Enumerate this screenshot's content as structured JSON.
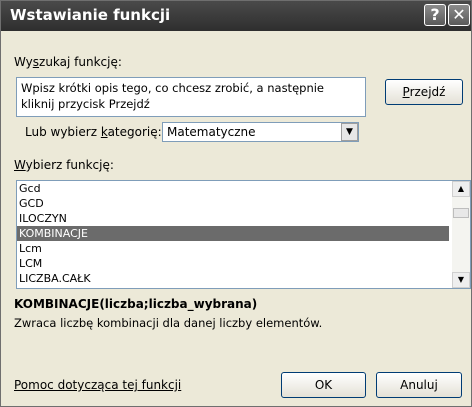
{
  "window": {
    "title": "Wstawianie funkcji",
    "help_glyph": "?",
    "close_glyph": "✕"
  },
  "search": {
    "label_pre": "Wy",
    "label_key": "s",
    "label_post": "zukaj funkcję:",
    "value": "Wpisz krótki opis tego, co chcesz zrobić, a następnie kliknij przycisk Przejdź",
    "go_label_key": "P",
    "go_label_rest": "rzejdź"
  },
  "category": {
    "label_pre": "Lub wybierz ",
    "label_key": "k",
    "label_post": "ategorię:",
    "selected": "Matematyczne"
  },
  "functions": {
    "label_key": "W",
    "label_rest": "ybierz funkcję:",
    "items": [
      "Gcd",
      "GCD",
      "ILOCZYN",
      "KOMBINACJE",
      "Lcm",
      "LCM",
      "LICZBA.CAŁK"
    ],
    "selected_index": 3
  },
  "details": {
    "signature": "KOMBINACJE(liczba;liczba_wybrana)",
    "description": "Zwraca liczbę kombinacji dla danej liczby elementów."
  },
  "footer": {
    "help_link": "Pomoc dotycząca tej funkcji",
    "ok_label": "OK",
    "cancel_label": "Anuluj"
  },
  "colors": {
    "dialog_bg": "#ece9d8",
    "title_bar": "#3a3a3a",
    "selection": "#6b6b6b"
  }
}
